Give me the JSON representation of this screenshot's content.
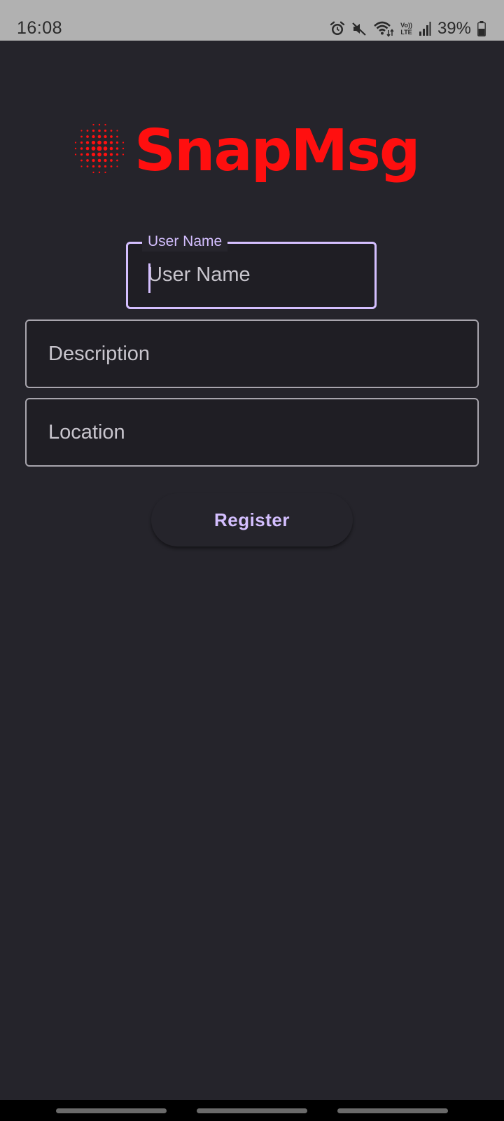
{
  "status_bar": {
    "time": "16:08",
    "lte_top": "Vo))",
    "lte_bottom": "LTE",
    "battery": "39%",
    "icons": [
      "alarm-icon",
      "mute-icon",
      "wifi-icon",
      "volte-icon",
      "signal-icon",
      "battery-icon"
    ]
  },
  "logo": {
    "text": "SnapMsg",
    "color": "#ff0f0f"
  },
  "form": {
    "username": {
      "label": "User Name",
      "placeholder": "User Name",
      "value": ""
    },
    "description": {
      "placeholder": "Description",
      "value": ""
    },
    "location": {
      "placeholder": "Location",
      "value": ""
    },
    "register_label": "Register"
  },
  "colors": {
    "background": "#25242b",
    "accent": "#d4bfff",
    "brand": "#ff0f0f"
  }
}
